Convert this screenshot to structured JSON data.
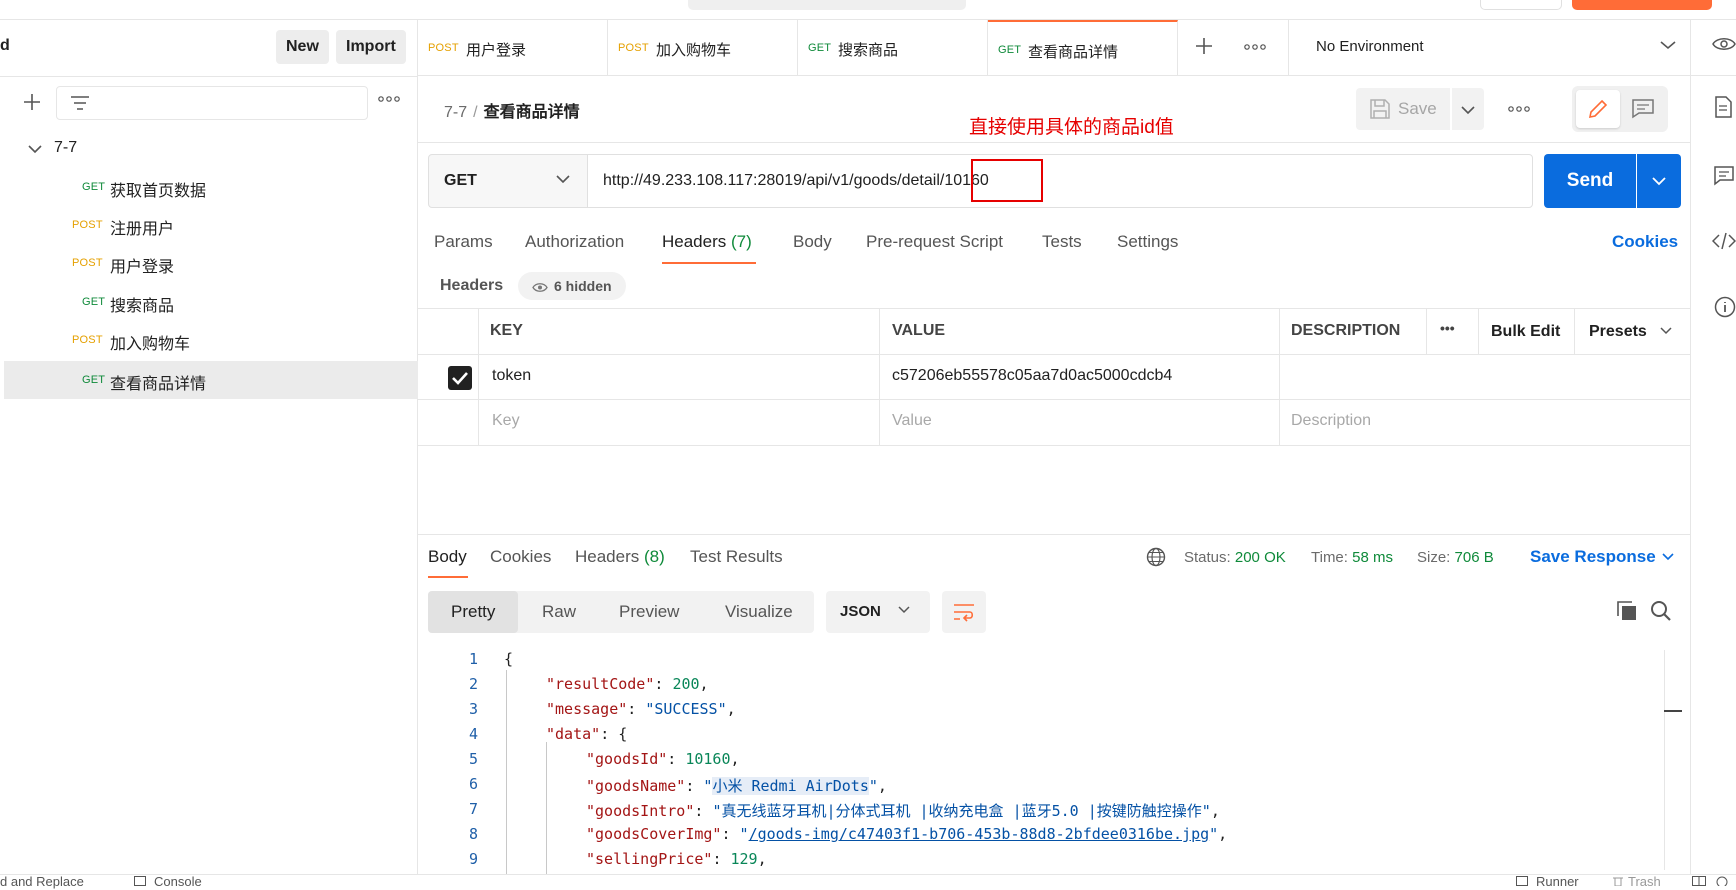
{
  "workspace": {
    "title": "d",
    "new_label": "New",
    "import_label": "Import"
  },
  "sidebar": {
    "collection": "7-7",
    "items": [
      {
        "method": "GET",
        "label": "获取首页数据"
      },
      {
        "method": "POST",
        "label": "注册用户"
      },
      {
        "method": "POST",
        "label": "用户登录"
      },
      {
        "method": "GET",
        "label": "搜索商品"
      },
      {
        "method": "POST",
        "label": "加入购物车"
      },
      {
        "method": "GET",
        "label": "查看商品详情"
      }
    ]
  },
  "tabs": [
    {
      "method": "POST",
      "label": "用户登录"
    },
    {
      "method": "POST",
      "label": "加入购物车"
    },
    {
      "method": "GET",
      "label": "搜索商品"
    },
    {
      "method": "GET",
      "label": "查看商品详情"
    }
  ],
  "environment": "No Environment",
  "request": {
    "breadcrumb_collection": "7-7",
    "breadcrumb_sep": "/",
    "name": "查看商品详情",
    "save_label": "Save",
    "method": "GET",
    "url": "http://49.233.108.117:28019/api/v1/goods/detail/10160",
    "send_label": "Send",
    "annotation": "直接使用具体的商品id值"
  },
  "request_tabs": {
    "params": "Params",
    "authorization": "Authorization",
    "headers": "Headers",
    "headers_count": "(7)",
    "body": "Body",
    "prerequest": "Pre-request Script",
    "tests": "Tests",
    "settings": "Settings",
    "cookies": "Cookies"
  },
  "headers_section": {
    "title": "Headers",
    "hidden": "6 hidden",
    "columns": {
      "key": "KEY",
      "value": "VALUE",
      "description": "DESCRIPTION",
      "more": "•••",
      "bulk_edit": "Bulk Edit",
      "presets": "Presets"
    },
    "rows": [
      {
        "key": "token",
        "value": "c57206eb55578c05aa7d0ac5000cdcb4",
        "checked": true
      }
    ],
    "placeholders": {
      "key": "Key",
      "value": "Value",
      "description": "Description"
    }
  },
  "response": {
    "tabs": {
      "body": "Body",
      "cookies": "Cookies",
      "headers": "Headers",
      "headers_count": "(8)",
      "test_results": "Test Results"
    },
    "status_label": "Status:",
    "status_value": "200 OK",
    "time_label": "Time:",
    "time_value": "58 ms",
    "size_label": "Size:",
    "size_value": "706 B",
    "save_response": "Save Response",
    "views": {
      "pretty": "Pretty",
      "raw": "Raw",
      "preview": "Preview",
      "visualize": "Visualize"
    },
    "format": "JSON",
    "code": {
      "l1": "{",
      "k_resultCode": "\"resultCode\"",
      "v_resultCode": "200",
      "k_message": "\"message\"",
      "v_message": "\"SUCCESS\"",
      "k_data": "\"data\"",
      "data_open": "{",
      "k_goodsId": "\"goodsId\"",
      "v_goodsId": "10160",
      "k_goodsName": "\"goodsName\"",
      "v_goodsName_q1": "\"",
      "v_goodsName": "小米 Redmi AirDots",
      "v_goodsName_q2": "\"",
      "k_goodsIntro": "\"goodsIntro\"",
      "v_goodsIntro": "\"真无线蓝牙耳机|分体式耳机 |收纳充电盒 |蓝牙5.0 |按键防触控操作\"",
      "k_goodsCoverImg": "\"goodsCoverImg\"",
      "v_goodsCoverImg_q1": "\"",
      "v_goodsCoverImg": "/goods-img/c47403f1-b706-453b-88d8-2bfdee0316be.jpg",
      "v_goodsCoverImg_q2": "\"",
      "k_sellingPrice": "\"sellingPrice\"",
      "v_sellingPrice": "129"
    }
  },
  "footer": {
    "left": "d and Replace",
    "console": "Console",
    "runner": "Runner",
    "trash": "Trash"
  },
  "colors": {
    "accent": "#ff6c37",
    "primary": "#0a6cde",
    "get": "#0f8a3a",
    "post": "#e5a000",
    "annotation": "#e60000"
  }
}
